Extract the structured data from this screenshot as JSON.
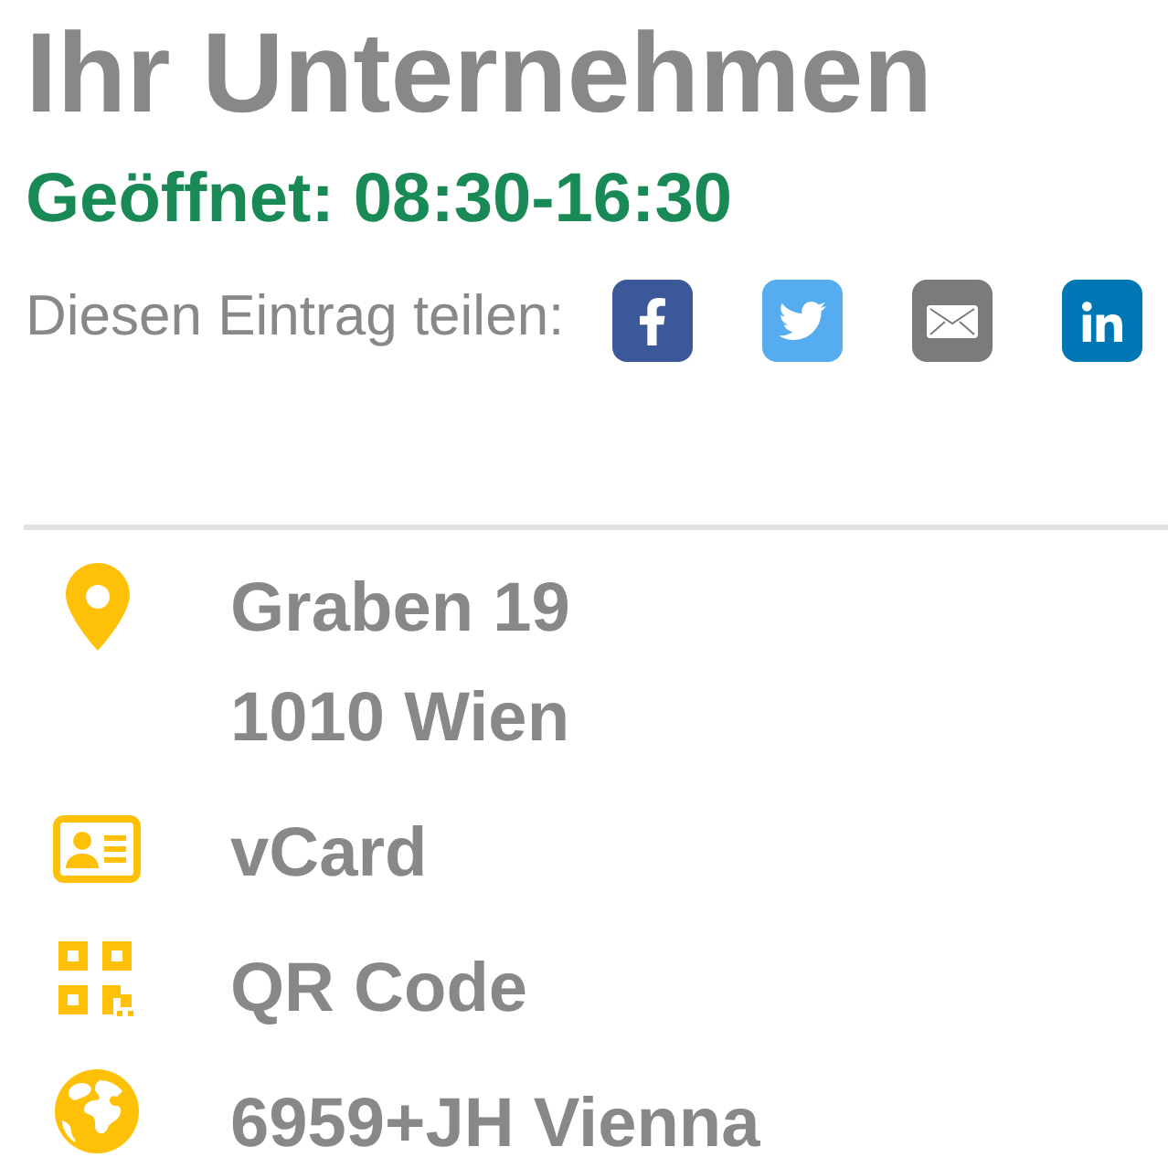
{
  "title": "Ihr Unternehmen",
  "opening_hours": "Geöffnet: 08:30-16:30",
  "share": {
    "label": "Diesen Eintrag teilen:",
    "buttons": [
      {
        "kind": "facebook"
      },
      {
        "kind": "twitter"
      },
      {
        "kind": "email"
      },
      {
        "kind": "linkedin"
      }
    ]
  },
  "details": [
    {
      "kind": "address",
      "lines": [
        "Graben 19",
        "1010 Wien"
      ]
    },
    {
      "kind": "vcard",
      "lines": [
        "vCard"
      ]
    },
    {
      "kind": "qr_code",
      "lines": [
        "QR Code"
      ]
    },
    {
      "kind": "plus_code",
      "lines": [
        "6959+JH Vienna"
      ]
    }
  ]
}
